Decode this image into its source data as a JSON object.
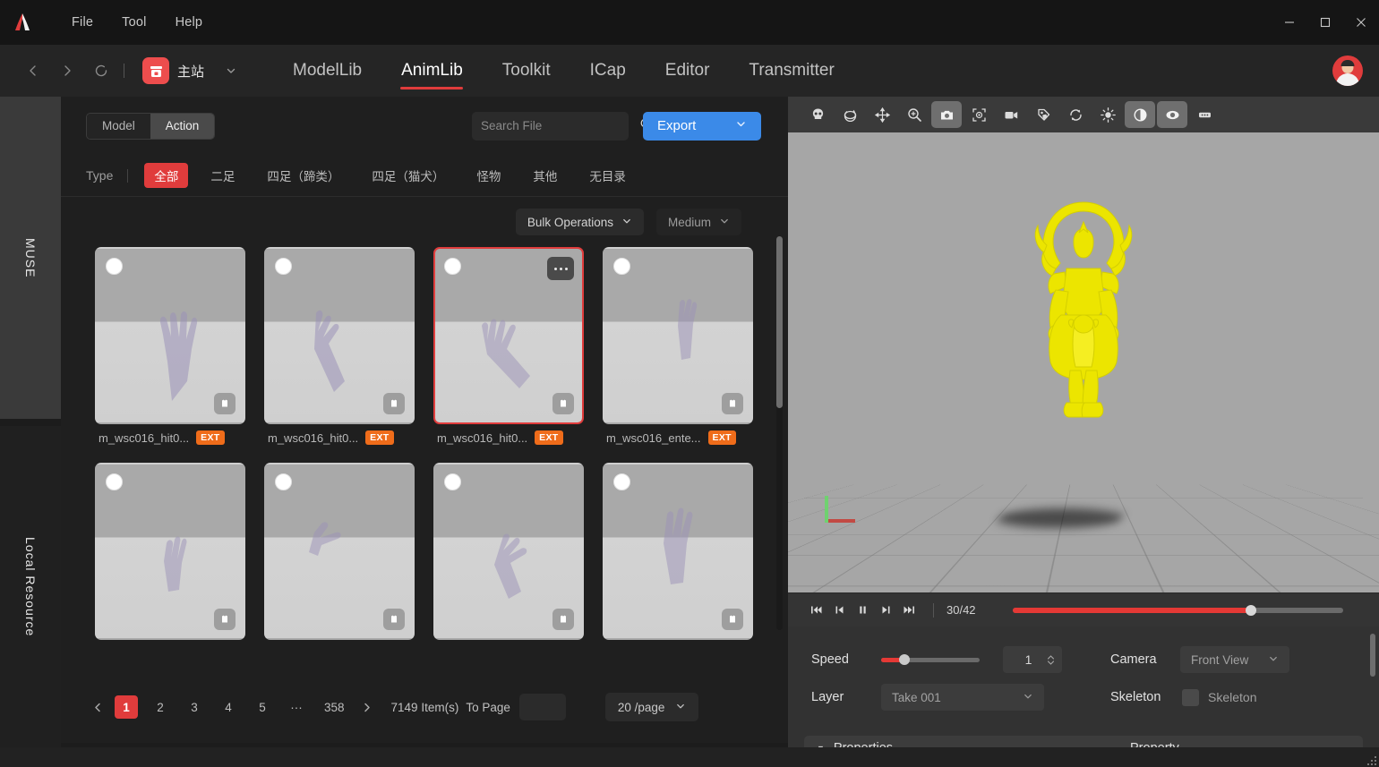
{
  "window": {
    "menus": [
      "File",
      "Tool",
      "Help"
    ],
    "controls": {
      "minimize": "minimize-icon",
      "maximize": "maximize-icon",
      "close": "close-icon"
    }
  },
  "nav": {
    "back": "back-icon",
    "forward": "forward-icon",
    "reload": "reload-icon",
    "site_label": "主站",
    "tabs": [
      {
        "label": "ModelLib",
        "active": false
      },
      {
        "label": "AnimLib",
        "active": true
      },
      {
        "label": "Toolkit",
        "active": false
      },
      {
        "label": "ICap",
        "active": false
      },
      {
        "label": "Editor",
        "active": false
      },
      {
        "label": "Transmitter",
        "active": false
      }
    ]
  },
  "rail": {
    "items": [
      {
        "label": "MUSE",
        "active": true
      },
      {
        "label": "Local Resource",
        "active": false
      }
    ]
  },
  "library": {
    "segmented": [
      {
        "label": "Model",
        "active": false
      },
      {
        "label": "Action",
        "active": true
      }
    ],
    "search": {
      "value": "",
      "placeholder": "Search File"
    },
    "export_label": "Export",
    "type_label": "Type",
    "type_chips": [
      {
        "label": "全部",
        "active": true
      },
      {
        "label": "二足",
        "active": false
      },
      {
        "label": "四足（蹄类）",
        "active": false
      },
      {
        "label": "四足（猫犬）",
        "active": false
      },
      {
        "label": "怪物",
        "active": false
      },
      {
        "label": "其他",
        "active": false
      },
      {
        "label": "无目录",
        "active": false
      }
    ],
    "bulk_operations_label": "Bulk Operations",
    "size_label": "Medium",
    "items": [
      {
        "name": "m_wsc016_hit0...",
        "badge": "EXT",
        "selected": false
      },
      {
        "name": "m_wsc016_hit0...",
        "badge": "EXT",
        "selected": false
      },
      {
        "name": "m_wsc016_hit0...",
        "badge": "EXT",
        "selected": true
      },
      {
        "name": "m_wsc016_ente...",
        "badge": "EXT",
        "selected": false
      },
      {
        "name": "",
        "badge": "",
        "selected": false
      },
      {
        "name": "",
        "badge": "",
        "selected": false
      },
      {
        "name": "",
        "badge": "",
        "selected": false
      },
      {
        "name": "",
        "badge": "",
        "selected": false
      }
    ],
    "pagination": {
      "pages": [
        "1",
        "2",
        "3",
        "4",
        "5",
        "···",
        "358"
      ],
      "current": "1",
      "total_text": "7149 Item(s)",
      "to_page_label": "To Page",
      "to_page_value": "",
      "page_size": "20 /page"
    }
  },
  "viewer": {
    "toolbar_icons": [
      {
        "name": "skull-icon",
        "active": false
      },
      {
        "name": "orbit-icon",
        "active": false
      },
      {
        "name": "move-icon",
        "active": false
      },
      {
        "name": "zoom-icon",
        "active": false
      },
      {
        "name": "camera-icon",
        "active": true
      },
      {
        "name": "focus-icon",
        "active": false
      },
      {
        "name": "video-icon",
        "active": false
      },
      {
        "name": "tag-icon",
        "active": false
      },
      {
        "name": "refresh-icon",
        "active": false
      },
      {
        "name": "brightness-icon",
        "active": false
      },
      {
        "name": "contrast-icon",
        "active": true
      },
      {
        "name": "visibility-icon",
        "active": true
      },
      {
        "name": "more-icon",
        "active": false
      }
    ],
    "transport": {
      "first_frame": "first-frame-icon",
      "prev_frame": "prev-frame-icon",
      "pause": "pause-icon",
      "next_frame": "next-frame-icon",
      "last_frame": "last-frame-icon",
      "frame_counter": "30/42",
      "progress_percent": 72
    },
    "properties": {
      "speed_label": "Speed",
      "speed_value": "1",
      "layer_label": "Layer",
      "layer_value": "Take 001",
      "camera_label": "Camera",
      "camera_value": "Front View",
      "skeleton_label": "Skeleton",
      "skeleton_checkbox_label": "Skeleton",
      "panel_left_title": "Properties",
      "panel_right_title": "Property"
    }
  },
  "colors": {
    "accent_red": "#e03c3c",
    "export_blue": "#3b8ae8",
    "badge_orange": "#ef6c1a",
    "model_yellow": "#ece500"
  }
}
